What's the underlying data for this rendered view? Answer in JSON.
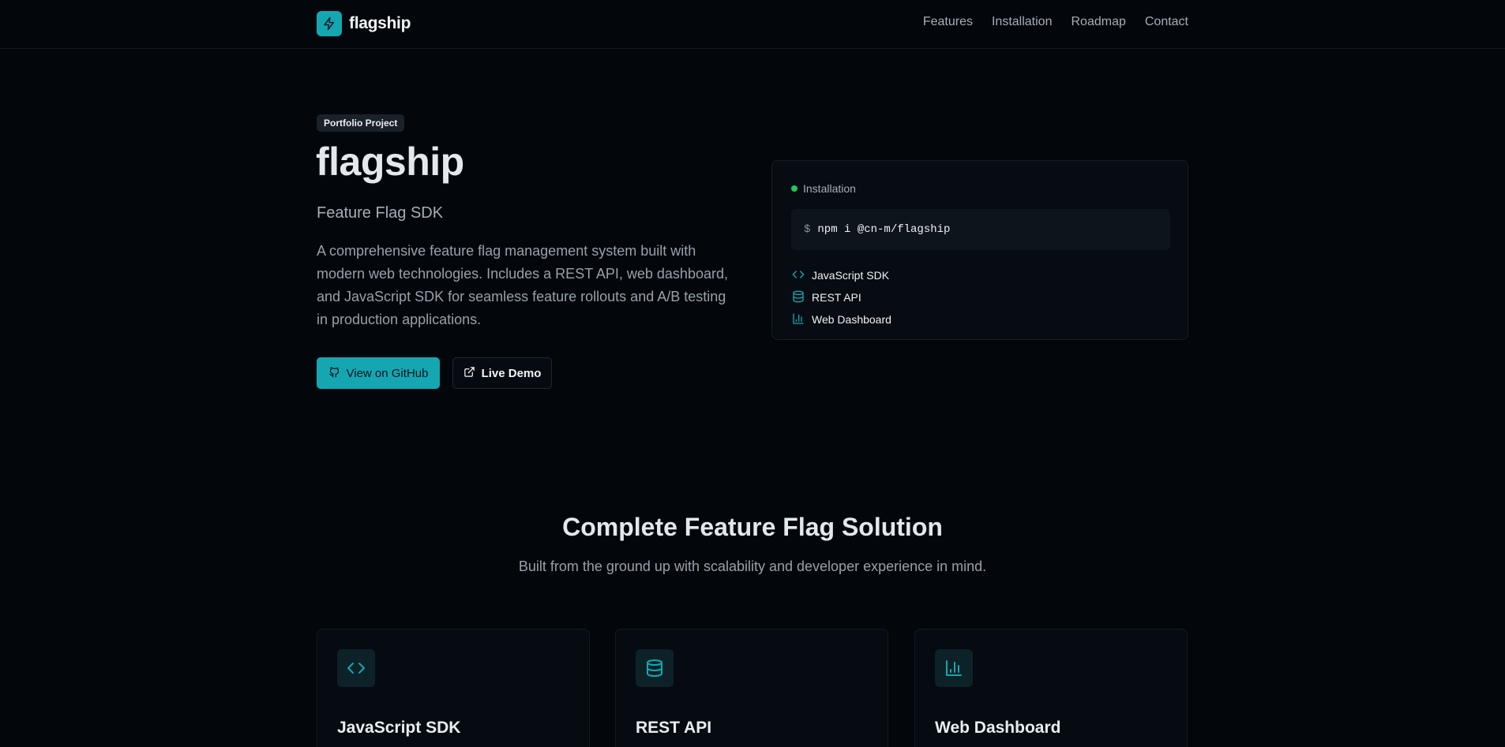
{
  "brand": {
    "name": "flagship",
    "icon": "lightning-bolt-icon",
    "accent": "#14a7b2"
  },
  "nav": {
    "links": [
      "Features",
      "Installation",
      "Roadmap",
      "Contact"
    ]
  },
  "hero": {
    "badge": "Portfolio Project",
    "title": "flagship",
    "subtitle": "Feature Flag SDK",
    "description": "A comprehensive feature flag management system built with modern web technologies. Includes a REST API, web dashboard, and JavaScript SDK for seamless feature rollouts and A/B testing in production applications.",
    "primary_button": "View on GitHub",
    "primary_icon": "github-icon",
    "secondary_button": "Live Demo",
    "secondary_icon": "external-link-icon"
  },
  "install": {
    "label": "Installation",
    "status_color": "#22c55e",
    "prompt": "$",
    "command": "npm i @cn-m/flagship",
    "items": [
      {
        "label": "JavaScript SDK",
        "icon": "code-icon"
      },
      {
        "label": "REST API",
        "icon": "database-icon"
      },
      {
        "label": "Web Dashboard",
        "icon": "bar-chart-icon"
      }
    ]
  },
  "features": {
    "title": "Complete Feature Flag Solution",
    "subtitle": "Built from the ground up with scalability and developer experience in mind.",
    "cards": [
      {
        "title": "JavaScript SDK",
        "icon": "code-icon"
      },
      {
        "title": "REST API",
        "icon": "database-icon"
      },
      {
        "title": "Web Dashboard",
        "icon": "bar-chart-icon"
      }
    ]
  }
}
